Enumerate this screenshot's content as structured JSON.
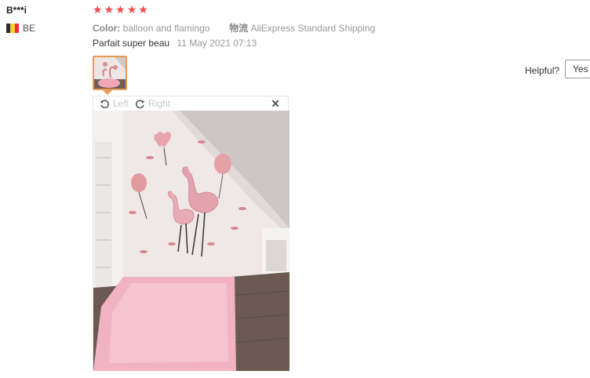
{
  "reviewer": {
    "name": "B***i",
    "country": "BE"
  },
  "rating": {
    "stars": 5,
    "max": 5
  },
  "product_meta": {
    "color_label": "Color:",
    "color_value": "balloon and flamingo",
    "shipping_label": "物流",
    "shipping_value": "AliExpress Standard Shipping"
  },
  "review": {
    "text": "Parfait super beau",
    "date": "11 May 2021 07:13"
  },
  "helpful": {
    "label": "Helpful?",
    "yes_label": "Yes ("
  },
  "viewer": {
    "left_label": "Left",
    "right_label": "Right",
    "close_glyph": "✕"
  },
  "colors": {
    "star": "#f04b4b",
    "thumb_border": "#e89a56",
    "flag": [
      "#2d2d2d",
      "#f5d130",
      "#e8303a"
    ]
  }
}
